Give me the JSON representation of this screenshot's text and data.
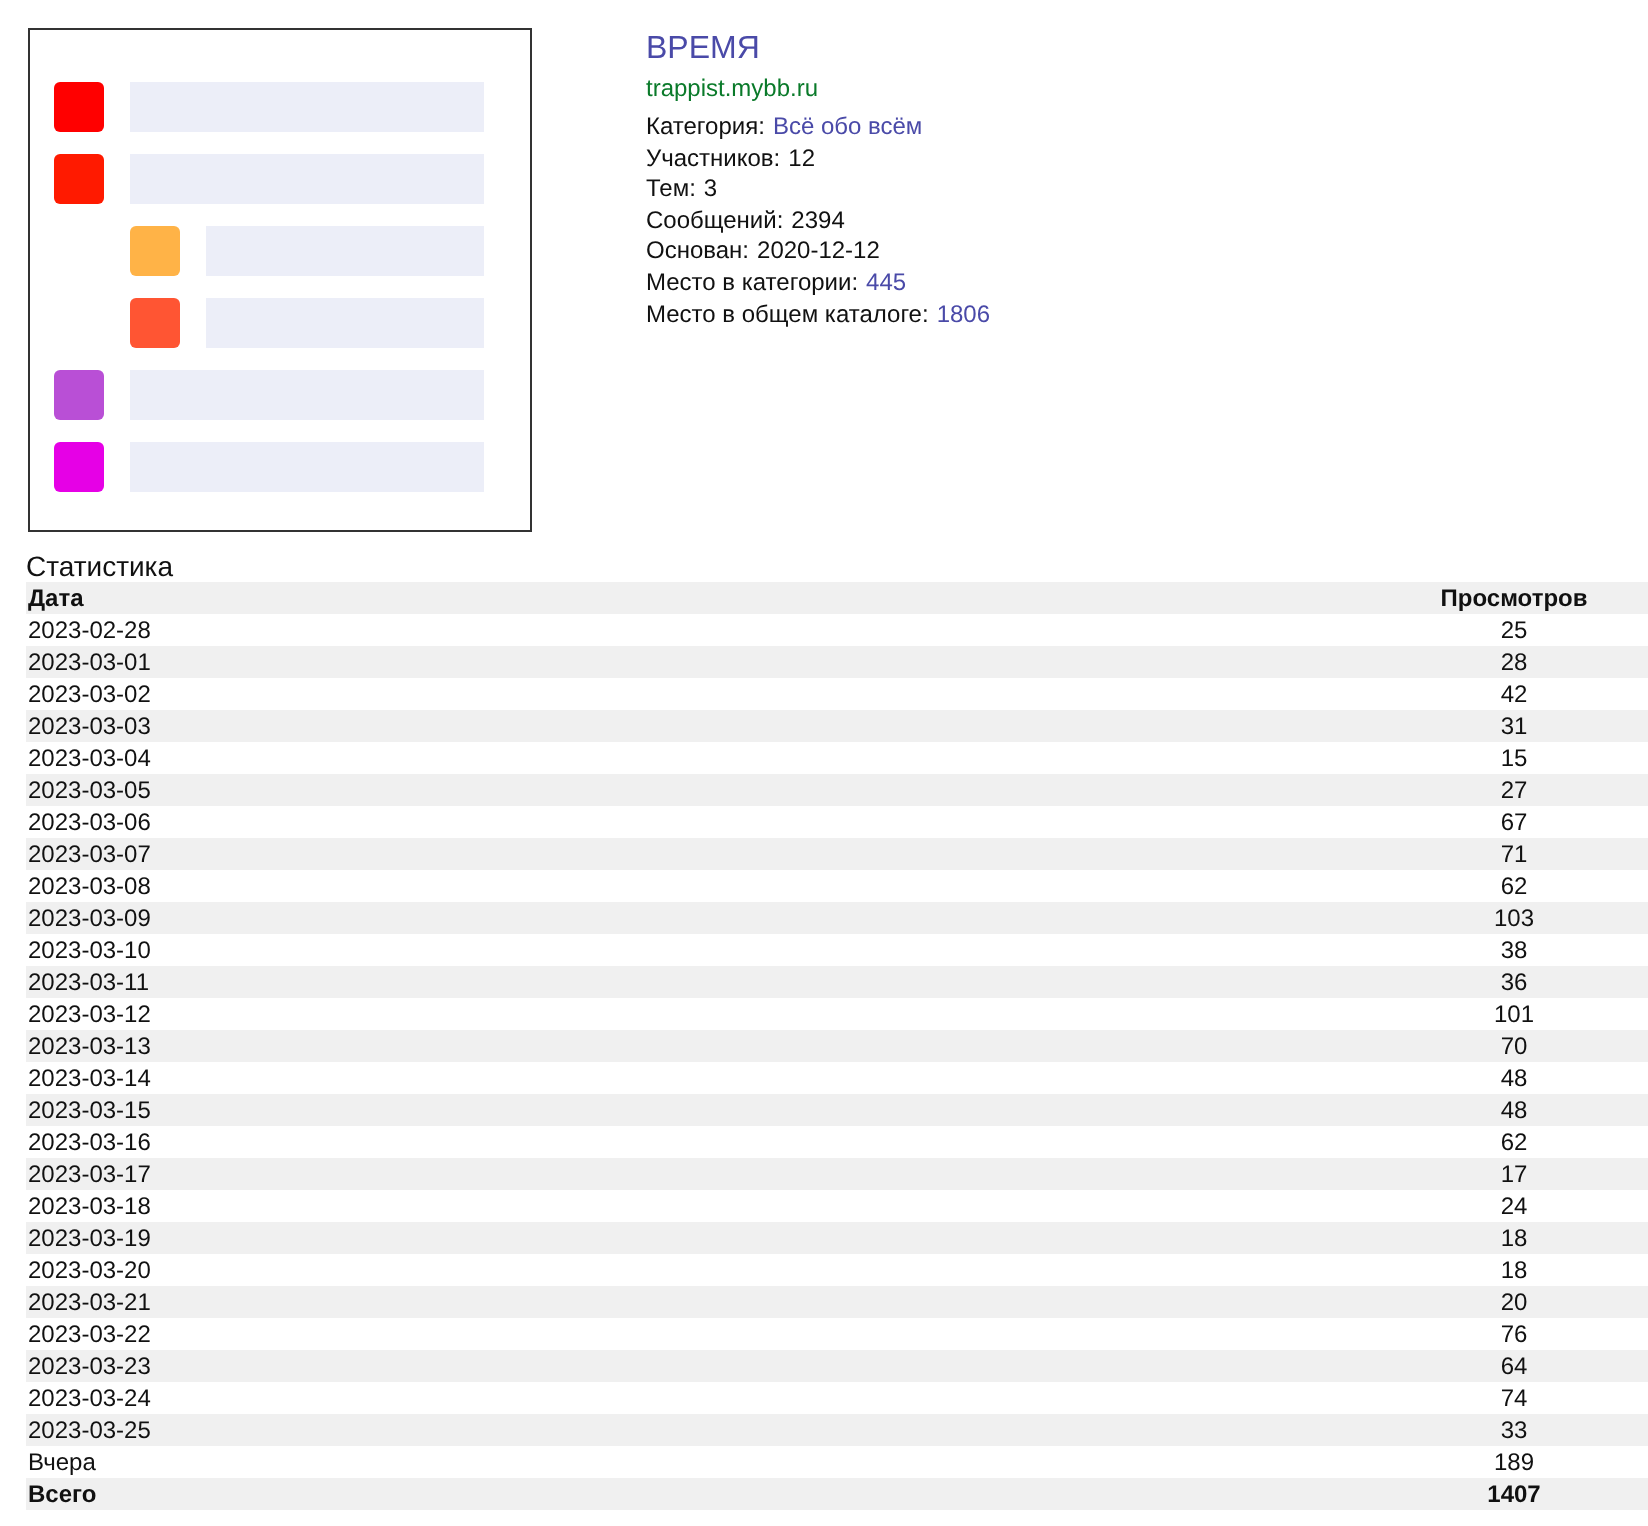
{
  "forum": {
    "title": "ВРЕМЯ",
    "url": "trappist.mybb.ru",
    "info": [
      {
        "label": "Категория:",
        "value": "Всё обо всём",
        "kind": "link"
      },
      {
        "label": "Участников:",
        "value": "12",
        "kind": "plain"
      },
      {
        "label": "Тем:",
        "value": "3",
        "kind": "plain"
      },
      {
        "label": "Сообщений:",
        "value": "2394",
        "kind": "plain"
      },
      {
        "label": "Основан:",
        "value": "2020-12-12",
        "kind": "plain"
      },
      {
        "label": "Место в категории:",
        "value": "445",
        "kind": "link"
      },
      {
        "label": "Место в общем каталоге:",
        "value": "1806",
        "kind": "link"
      }
    ]
  },
  "stats": {
    "title": "Статистика",
    "columns": [
      "Дата",
      "Просмотров"
    ],
    "rows": [
      {
        "date": "2023-02-28",
        "views": "25",
        "kind": "day"
      },
      {
        "date": "2023-03-01",
        "views": "28",
        "kind": "day"
      },
      {
        "date": "2023-03-02",
        "views": "42",
        "kind": "day"
      },
      {
        "date": "2023-03-03",
        "views": "31",
        "kind": "day"
      },
      {
        "date": "2023-03-04",
        "views": "15",
        "kind": "day"
      },
      {
        "date": "2023-03-05",
        "views": "27",
        "kind": "day"
      },
      {
        "date": "2023-03-06",
        "views": "67",
        "kind": "day"
      },
      {
        "date": "2023-03-07",
        "views": "71",
        "kind": "day"
      },
      {
        "date": "2023-03-08",
        "views": "62",
        "kind": "day"
      },
      {
        "date": "2023-03-09",
        "views": "103",
        "kind": "day"
      },
      {
        "date": "2023-03-10",
        "views": "38",
        "kind": "day"
      },
      {
        "date": "2023-03-11",
        "views": "36",
        "kind": "day"
      },
      {
        "date": "2023-03-12",
        "views": "101",
        "kind": "day"
      },
      {
        "date": "2023-03-13",
        "views": "70",
        "kind": "day"
      },
      {
        "date": "2023-03-14",
        "views": "48",
        "kind": "day"
      },
      {
        "date": "2023-03-15",
        "views": "48",
        "kind": "day"
      },
      {
        "date": "2023-03-16",
        "views": "62",
        "kind": "day"
      },
      {
        "date": "2023-03-17",
        "views": "17",
        "kind": "day"
      },
      {
        "date": "2023-03-18",
        "views": "24",
        "kind": "day"
      },
      {
        "date": "2023-03-19",
        "views": "18",
        "kind": "day"
      },
      {
        "date": "2023-03-20",
        "views": "18",
        "kind": "day"
      },
      {
        "date": "2023-03-21",
        "views": "20",
        "kind": "day"
      },
      {
        "date": "2023-03-22",
        "views": "76",
        "kind": "day"
      },
      {
        "date": "2023-03-23",
        "views": "64",
        "kind": "day"
      },
      {
        "date": "2023-03-24",
        "views": "74",
        "kind": "day"
      },
      {
        "date": "2023-03-25",
        "views": "33",
        "kind": "day"
      },
      {
        "date": "Вчера",
        "views": "189",
        "kind": "day"
      },
      {
        "date": "Всего",
        "views": "1407",
        "kind": "total"
      }
    ]
  }
}
